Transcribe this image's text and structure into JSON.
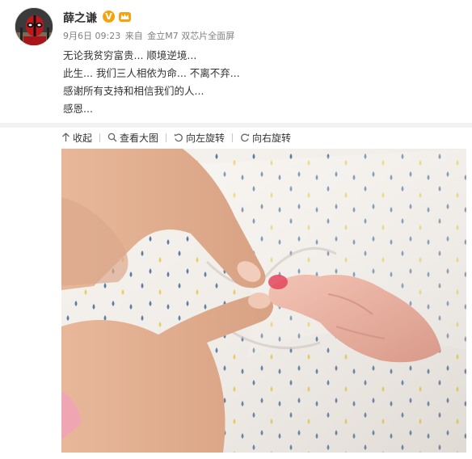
{
  "user": {
    "name": "薛之谦",
    "verified_badge": "V",
    "avatar": "deadpool-avatar"
  },
  "meta": {
    "date": "9月6日 09:23",
    "source_prefix": "来自",
    "source": "金立M7 双芯片全面屏"
  },
  "post": {
    "lines": [
      "无论我贫穷富贵... 顺境逆境...",
      "此生... 我们三人相依为命... 不离不弃...",
      "感谢所有支持和相信我们的人...",
      "感恩..."
    ]
  },
  "toolbar": {
    "collapse_label": "收起",
    "view_large_label": "查看大图",
    "rotate_left_label": "向左旋转",
    "rotate_right_label": "向右旋转"
  },
  "colors": {
    "accent": "#f7a20c",
    "meta_text": "#808080",
    "divider": "#f2f2f5"
  }
}
